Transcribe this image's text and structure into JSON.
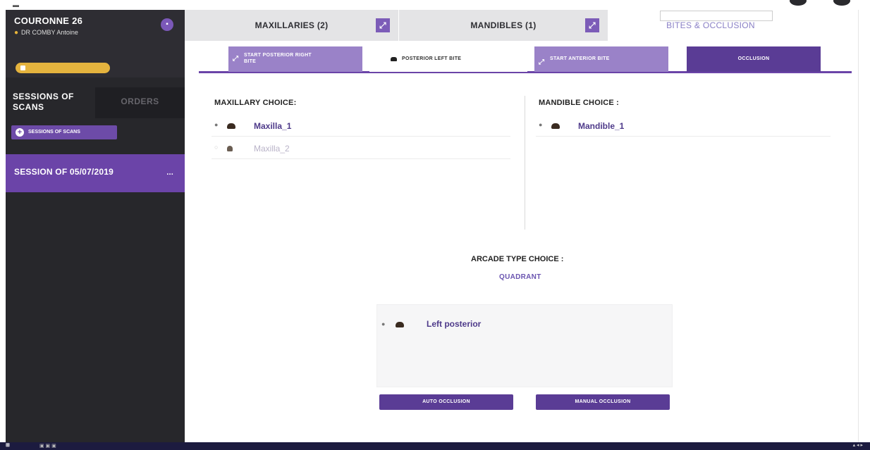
{
  "patient": {
    "name": "COURONNE 26",
    "doctor": "DR COMBY Antoine",
    "subtitle": "",
    "badge": ""
  },
  "sidebar": {
    "tabs": [
      {
        "label": "SESSIONS OF SCANS"
      },
      {
        "label": "ORDERS"
      }
    ],
    "add_session_label": "SESSIONS OF SCANS",
    "session": {
      "label": "SESSION OF 05/07/2019",
      "menu": "..."
    }
  },
  "scan_tabs": [
    {
      "label": "MAXILLARIES (2)"
    },
    {
      "label": "MANDIBLES (1)"
    },
    {
      "label": "BITES & OCCLUSION"
    }
  ],
  "tooltip_text": "",
  "bite_tabs": [
    {
      "label": "START POSTERIOR RIGHT BITE"
    },
    {
      "label": "POSTERIOR LEFT BITE"
    },
    {
      "label": "START ANTERIOR BITE"
    },
    {
      "label": "OCCLUSION"
    }
  ],
  "maxillary": {
    "label": "MAXILLARY CHOICE:",
    "items": [
      {
        "label": "Maxilla_1",
        "selected": true
      },
      {
        "label": "Maxilla_2",
        "selected": false
      }
    ]
  },
  "mandible": {
    "label": "MANDIBLE CHOICE :",
    "items": [
      {
        "label": "Mandible_1",
        "selected": true
      }
    ]
  },
  "arcade": {
    "label": "ARCADE TYPE CHOICE :",
    "value": "QUADRANT"
  },
  "bite_list": {
    "items": [
      {
        "label": "Left posterior"
      }
    ]
  },
  "buttons": {
    "auto": "AUTO OCCLUSION",
    "manual": "MANUAL OCCLUSION"
  },
  "colors": {
    "accent": "#6b44a8",
    "sidebar": "#27272b",
    "dark_button": "#5a3c95"
  }
}
